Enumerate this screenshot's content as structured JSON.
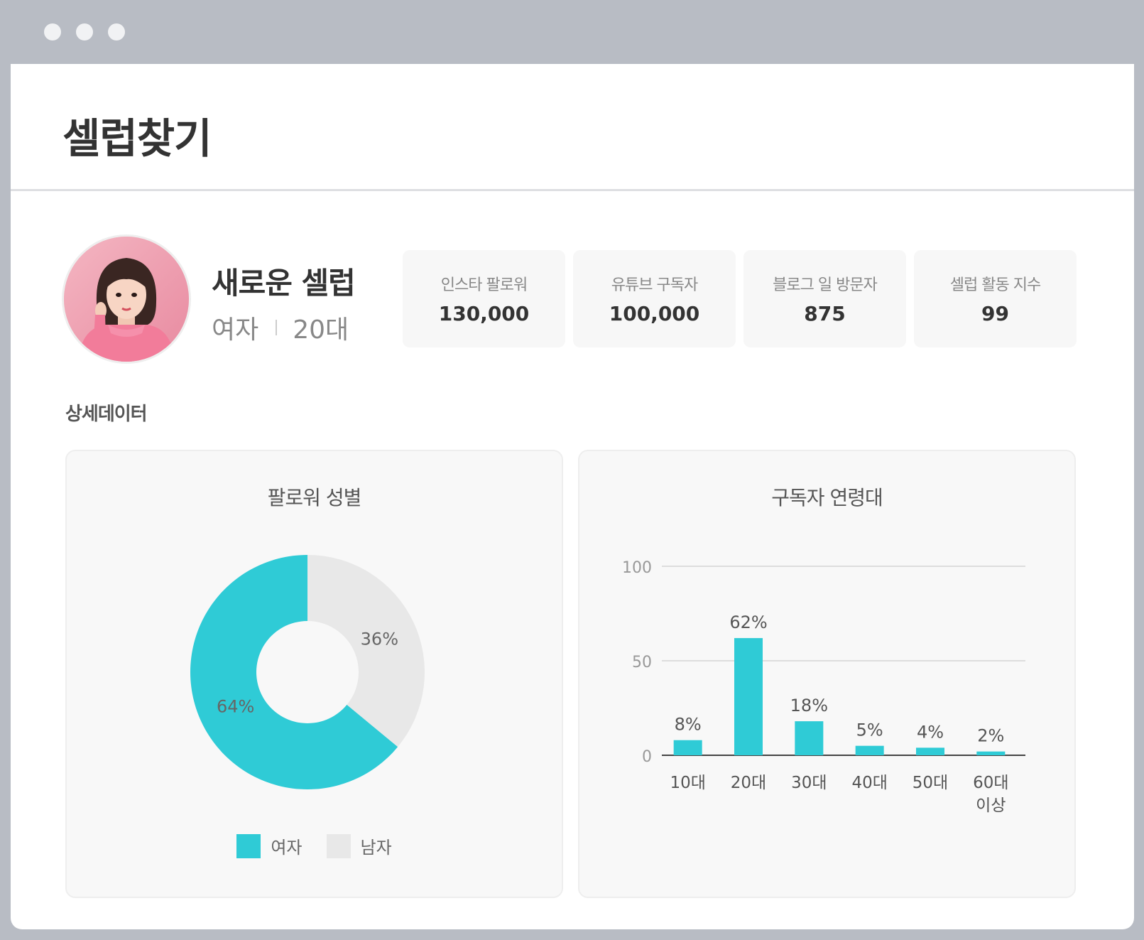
{
  "page": {
    "title": "셀럽찾기"
  },
  "profile": {
    "name": "새로운 셀럽",
    "gender": "여자",
    "age_group": "20대"
  },
  "stats": [
    {
      "label": "인스타 팔로워",
      "value": "130,000"
    },
    {
      "label": "유튜브 구독자",
      "value": "100,000"
    },
    {
      "label": "블로그 일 방문자",
      "value": "875"
    },
    {
      "label": "셀럽 활동 지수",
      "value": "99"
    }
  ],
  "section": {
    "title": "상세데이터"
  },
  "colors": {
    "accent": "#2fcbd6",
    "secondary": "#e8e8e8"
  },
  "chart_data": [
    {
      "type": "pie",
      "title": "팔로워 성별",
      "categories": [
        "여자",
        "남자"
      ],
      "values": [
        64,
        36
      ],
      "value_labels": [
        "64%",
        "36%"
      ],
      "colors": [
        "#2fcbd6",
        "#e8e8e8"
      ],
      "donut": true,
      "legend": "bottom"
    },
    {
      "type": "bar",
      "title": "구독자 연령대",
      "categories": [
        "10대",
        "20대",
        "30대",
        "40대",
        "50대",
        "60대 이상"
      ],
      "values": [
        8,
        62,
        18,
        5,
        4,
        2
      ],
      "value_labels": [
        "8%",
        "62%",
        "18%",
        "5%",
        "4%",
        "2%"
      ],
      "ylim": [
        0,
        100
      ],
      "yticks": [
        "0",
        "50",
        "100"
      ],
      "grid": true,
      "color": "#2fcbd6"
    }
  ]
}
